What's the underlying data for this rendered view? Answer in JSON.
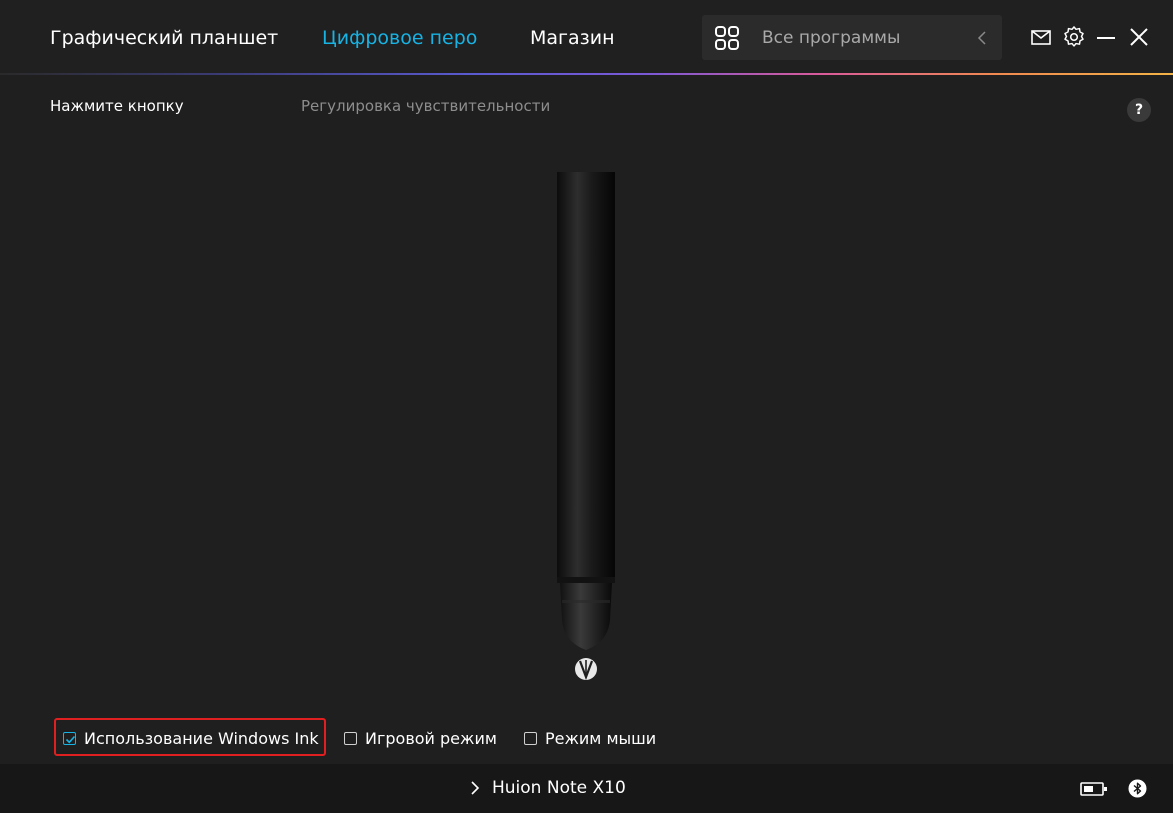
{
  "nav": {
    "tabs": [
      {
        "label": "Графический планшет"
      },
      {
        "label": "Цифровое перо"
      },
      {
        "label": "Магазин"
      }
    ],
    "active_tab": 1,
    "search": {
      "label": "Все программы",
      "icon": "grid-icon"
    },
    "icons": [
      "mail-icon",
      "gear-icon",
      "minimize-icon",
      "close-icon"
    ]
  },
  "subtabs": [
    {
      "label": "Нажмите кнопку"
    },
    {
      "label": "Регулировка чувствительности"
    }
  ],
  "help_label": "?",
  "options": [
    {
      "label": "Использование Windows Ink",
      "checked": true
    },
    {
      "label": "Игровой режим",
      "checked": false
    },
    {
      "label": "Режим мыши",
      "checked": false
    }
  ],
  "bottombar": {
    "device_name": "Huion Note X10",
    "battery_icon": "battery-icon",
    "bluetooth_icon": "bluetooth-icon"
  },
  "colors": {
    "accent": "#17b3e4",
    "background": "#1f1f1f",
    "highlight_border": "#e02020"
  }
}
